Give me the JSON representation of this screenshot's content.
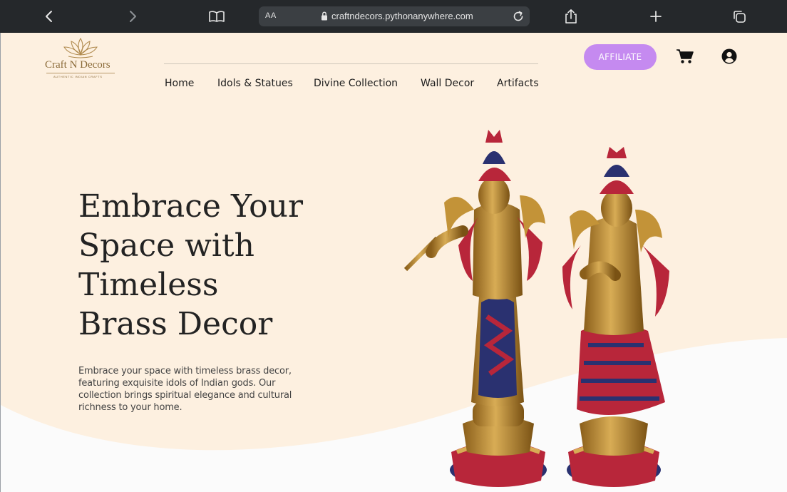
{
  "browser": {
    "address_size_label": "AA",
    "url": "craftndecors.pythonanywhere.com",
    "icons": [
      "back-icon",
      "forward-icon",
      "bookmarks-icon",
      "lock-icon",
      "reload-icon",
      "share-icon",
      "new-tab-icon",
      "tabs-icon"
    ]
  },
  "brand": {
    "name": "Craft N Decors",
    "tagline": "AUTHENTIC INDIAN CRAFTS",
    "color": "#8a6a38"
  },
  "nav": {
    "items": [
      {
        "label": "Home"
      },
      {
        "label": "Idols & Statues"
      },
      {
        "label": "Divine Collection"
      },
      {
        "label": "Wall Decor"
      },
      {
        "label": "Artifacts"
      }
    ]
  },
  "header": {
    "affiliate_label": "AFFILIATE",
    "affiliate_color": "#c58af0",
    "icons": [
      "cart-icon",
      "account-icon"
    ]
  },
  "hero": {
    "headline_lines": [
      "Embrace Your",
      "Space with",
      "Timeless",
      "Brass Decor"
    ],
    "description": "Embrace your space with timeless brass decor, featuring exquisite idols of Indian gods. Our collection brings spiritual elegance and cultural richness to your home.",
    "background_color": "#fdf0e0"
  }
}
